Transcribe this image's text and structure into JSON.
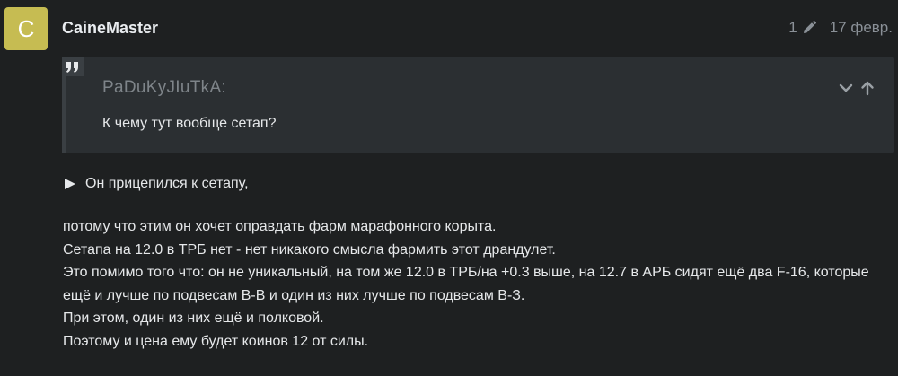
{
  "post": {
    "avatar_letter": "C",
    "avatar_color": "#c6bc52",
    "username": "CaineMaster",
    "edit_count": "1",
    "date": "17 февр."
  },
  "quote": {
    "icon": "quote-icon",
    "author": "PaDuKyJIuTkA:",
    "text": "К чему тут вообще сетап?"
  },
  "details": {
    "summary": "Он прицепился к сетапу,"
  },
  "body": {
    "lines": [
      "потому что этим он хочет оправдать фарм марафонного корыта.",
      "Сетапа на 12.0 в ТРБ нет - нет никакого смысла фармить этот драндулет.",
      "Это помимо того что: он не уникальный, на том же 12.0 в ТРБ/на +0.3 выше, на 12.7 в АРБ сидят ещё два F-16, которые ещё и лучше по подвесам В-В и один из них лучше по подвесам В-З.",
      "При этом, один из них ещё и полковой.",
      "Поэтому и цена ему будет коинов 12 от силы."
    ]
  }
}
